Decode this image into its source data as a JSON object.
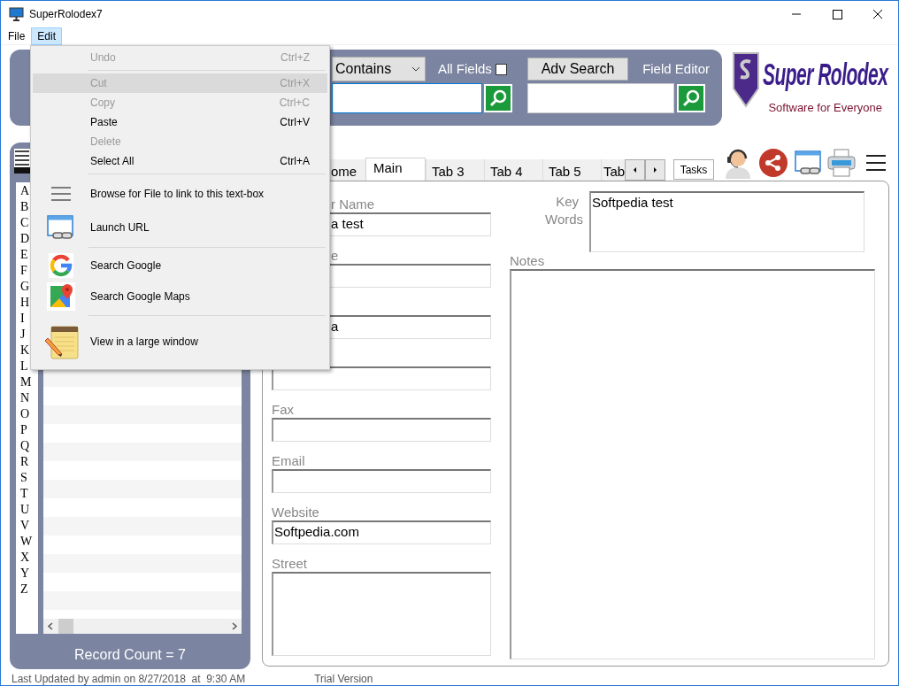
{
  "window": {
    "title": "SuperRolodex7"
  },
  "menu_bar": [
    {
      "label": "File",
      "selected": false
    },
    {
      "label": "Edit",
      "selected": true
    }
  ],
  "edit_menu": [
    {
      "kind": "item",
      "label": "Undo",
      "shortcut": "Ctrl+Z",
      "disabled": true,
      "highlighted": false
    },
    {
      "kind": "separator"
    },
    {
      "kind": "item",
      "label": "Cut",
      "shortcut": "Ctrl+X",
      "disabled": true,
      "highlighted": true
    },
    {
      "kind": "item",
      "label": "Copy",
      "shortcut": "Ctrl+C",
      "disabled": true,
      "highlighted": false
    },
    {
      "kind": "item",
      "label": "Paste",
      "shortcut": "Ctrl+V",
      "disabled": false,
      "highlighted": false
    },
    {
      "kind": "item",
      "label": "Delete",
      "disabled": true,
      "highlighted": false
    },
    {
      "kind": "item",
      "label": "Select All",
      "shortcut": "Ctrl+A",
      "disabled": false,
      "highlighted": false
    },
    {
      "kind": "separator"
    },
    {
      "kind": "icon_item",
      "label": "Browse for File to link to this text-box",
      "disabled": false,
      "highlighted": false
    },
    {
      "kind": "icon_item",
      "label": "Launch URL",
      "disabled": false,
      "highlighted": false
    },
    {
      "kind": "separator"
    },
    {
      "kind": "icon_item",
      "label": "Search Google",
      "disabled": false,
      "highlighted": false
    },
    {
      "kind": "icon_item",
      "label": "Search Google Maps",
      "disabled": false,
      "highlighted": false
    },
    {
      "kind": "separator"
    },
    {
      "kind": "icon_item",
      "label": "View in a large window",
      "disabled": false,
      "highlighted": false
    }
  ],
  "search": {
    "match_mode": "Contains",
    "all_fields_label": "All Fields",
    "all_fields_checked": false,
    "adv_search": "Adv Search",
    "field_editor": "Field Editor"
  },
  "logo": {
    "name": "Super Rolodex",
    "tagline": "Software for Everyone"
  },
  "alphabet": [
    "A",
    "B",
    "C",
    "D",
    "E",
    "F",
    "G",
    "H",
    "I",
    "J",
    "K",
    "L",
    "M",
    "N",
    "O",
    "P",
    "Q",
    "R",
    "S",
    "T",
    "U",
    "V",
    "W",
    "X",
    "Y",
    "Z"
  ],
  "record_count": "Record Count = 7",
  "tabs": [
    {
      "label": "ome",
      "selected": false
    },
    {
      "label": "Main",
      "selected": true
    },
    {
      "label": "Tab 3",
      "selected": false
    },
    {
      "label": "Tab 4",
      "selected": false
    },
    {
      "label": "Tab 5",
      "selected": false
    },
    {
      "label": "Tab",
      "selected": false
    }
  ],
  "tasks_button": "Tasks",
  "fields": [
    {
      "kind": "line",
      "label": "r Name",
      "value": "a test",
      "partly_hidden": true
    },
    {
      "kind": "line",
      "label": "e",
      "partly_hidden": true
    },
    {
      "kind": "line",
      "value": "a",
      "partly_hidden": true
    },
    {
      "kind": "line"
    },
    {
      "kind": "line",
      "label": "Fax"
    },
    {
      "kind": "line",
      "label": "Email"
    },
    {
      "kind": "line",
      "label": "Website",
      "value": "Softpedia.com"
    },
    {
      "kind": "area",
      "label": "Street"
    }
  ],
  "key_words": {
    "label": "Key Words",
    "value": "Softpedia test"
  },
  "notes": {
    "label": "Notes"
  },
  "status_bar": {
    "last_updated": "Last Updated by admin on 8/27/2018  at  9:30 AM",
    "trial": "Trial Version"
  }
}
